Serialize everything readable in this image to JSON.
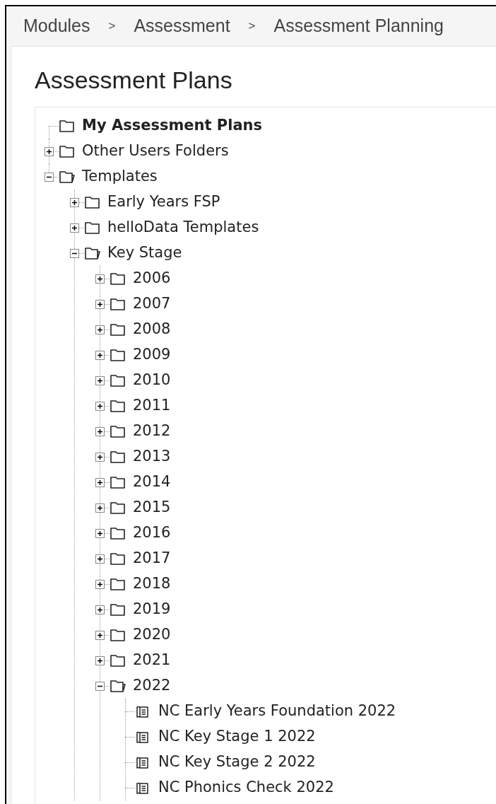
{
  "breadcrumb": [
    "Modules",
    "Assessment",
    "Assessment Planning"
  ],
  "breadcrumb_separator": ">",
  "title": "Assessment Plans",
  "tree": [
    {
      "label": "My Assessment Plans",
      "kind": "folder",
      "selected": true
    },
    {
      "label": "Other Users Folders",
      "kind": "folder",
      "selected": false,
      "expanded": false
    },
    {
      "label": "Templates",
      "kind": "folder",
      "selected": false,
      "expanded": true,
      "children": [
        {
          "label": "Early Years FSP",
          "kind": "folder",
          "selected": false,
          "expanded": false
        },
        {
          "label": "helloData Templates",
          "kind": "folder",
          "selected": false,
          "expanded": false
        },
        {
          "label": "Key Stage",
          "kind": "folder",
          "selected": false,
          "expanded": true,
          "children": [
            {
              "label": "2006",
              "kind": "folder",
              "selected": false,
              "expanded": false
            },
            {
              "label": "2007",
              "kind": "folder",
              "selected": false,
              "expanded": false
            },
            {
              "label": "2008",
              "kind": "folder",
              "selected": false,
              "expanded": false
            },
            {
              "label": "2009",
              "kind": "folder",
              "selected": false,
              "expanded": false
            },
            {
              "label": "2010",
              "kind": "folder",
              "selected": false,
              "expanded": false
            },
            {
              "label": "2011",
              "kind": "folder",
              "selected": false,
              "expanded": false
            },
            {
              "label": "2012",
              "kind": "folder",
              "selected": false,
              "expanded": false
            },
            {
              "label": "2013",
              "kind": "folder",
              "selected": false,
              "expanded": false
            },
            {
              "label": "2014",
              "kind": "folder",
              "selected": false,
              "expanded": false
            },
            {
              "label": "2015",
              "kind": "folder",
              "selected": false,
              "expanded": false
            },
            {
              "label": "2016",
              "kind": "folder",
              "selected": false,
              "expanded": false
            },
            {
              "label": "2017",
              "kind": "folder",
              "selected": false,
              "expanded": false
            },
            {
              "label": "2018",
              "kind": "folder",
              "selected": false,
              "expanded": false
            },
            {
              "label": "2019",
              "kind": "folder",
              "selected": false,
              "expanded": false
            },
            {
              "label": "2020",
              "kind": "folder",
              "selected": false,
              "expanded": false
            },
            {
              "label": "2021",
              "kind": "folder",
              "selected": false,
              "expanded": false
            },
            {
              "label": "2022",
              "kind": "folder",
              "selected": false,
              "expanded": true,
              "children": [
                {
                  "label": "NC Early Years Foundation 2022",
                  "kind": "plan",
                  "selected": false
                },
                {
                  "label": "NC Key Stage 1 2022",
                  "kind": "plan",
                  "selected": false
                },
                {
                  "label": "NC Key Stage 2 2022",
                  "kind": "plan",
                  "selected": false
                },
                {
                  "label": "NC Phonics Check 2022",
                  "kind": "plan",
                  "selected": false
                }
              ]
            }
          ]
        }
      ]
    }
  ]
}
